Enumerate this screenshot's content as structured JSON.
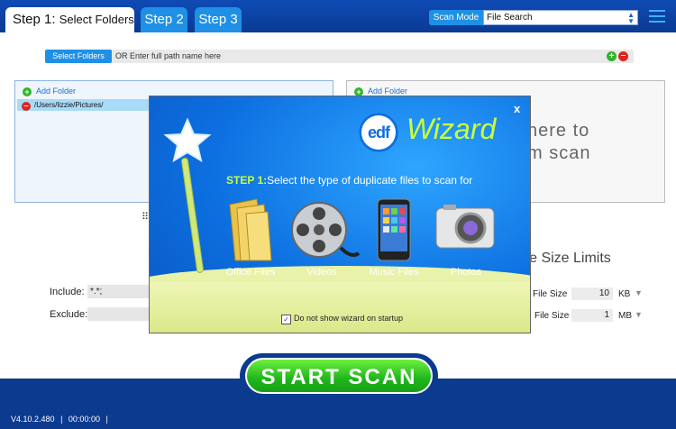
{
  "tabs": {
    "step1_prefix": "Step 1:",
    "step1_name": "Select Folders",
    "step2": "Step 2",
    "step3": "Step 3"
  },
  "scan_mode": {
    "label": "Scan Mode",
    "value": "File Search"
  },
  "path_bar": {
    "select_button": "Select Folders",
    "hint": "OR Enter full path name here"
  },
  "left_panel": {
    "add_label": "Add Folder",
    "folders": [
      "/Users/lizzie/Pictures/"
    ]
  },
  "right_panel": {
    "add_label": "Add Folder",
    "hint_line1": "here to",
    "hint_line2": "m scan"
  },
  "filters": {
    "include_label": "Include:",
    "include_value": "*.*;",
    "exclude_label": "Exclude:",
    "exclude_value": ""
  },
  "file_size": {
    "title": "ile Size Limits",
    "min_label": "File Size",
    "min_value": "10",
    "min_unit": "KB",
    "max_label": "File Size",
    "max_value": "1",
    "max_unit": "MB"
  },
  "start_button": "START SCAN",
  "status": {
    "version": "V4.10.2.480",
    "timer": "00:00:00"
  },
  "wizard": {
    "close": "x",
    "logo": "edf",
    "title": "Wizard",
    "step_label": "STEP 1:",
    "step_text": "Select the type of duplicate files to scan for",
    "options": [
      "Office Files",
      "Videos",
      "Music Files",
      "Photos"
    ],
    "checkbox_label": "Do not show wizard on startup",
    "checkbox_checked": true
  },
  "colors": {
    "brand_blue": "#0b3a8e",
    "tab_blue": "#1e90e6",
    "wizard_accent": "#c9ff3a",
    "start_green": "#1fb51c"
  }
}
